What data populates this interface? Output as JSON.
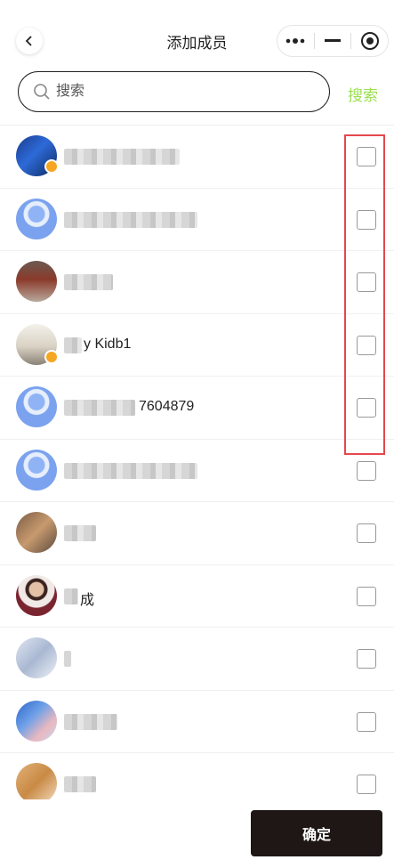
{
  "header": {
    "title": "添加成员",
    "back_icon": "chevron-left-icon",
    "capsule_icons": [
      "more-dots-icon",
      "minimize-icon",
      "close-circle-icon"
    ]
  },
  "search": {
    "placeholder": "搜索",
    "button_label": "搜索",
    "accent_color": "#9be050"
  },
  "members": [
    {
      "name": "",
      "checked": false,
      "badge": true
    },
    {
      "name": "",
      "checked": false,
      "badge": false
    },
    {
      "name": "",
      "checked": false,
      "badge": false
    },
    {
      "name": "y Kidb1",
      "checked": false,
      "badge": true
    },
    {
      "name": "7604879",
      "checked": false,
      "badge": false
    },
    {
      "name": "",
      "checked": false,
      "badge": false
    },
    {
      "name": "",
      "checked": false,
      "badge": false
    },
    {
      "name": "成",
      "checked": false,
      "badge": false
    },
    {
      "name": "",
      "checked": false,
      "badge": false
    },
    {
      "name": "",
      "checked": false,
      "badge": false
    },
    {
      "name": "",
      "checked": false,
      "badge": false
    }
  ],
  "footer": {
    "confirm_label": "确定",
    "confirm_color": "#1e1716"
  },
  "highlight_color": "#e5484d"
}
